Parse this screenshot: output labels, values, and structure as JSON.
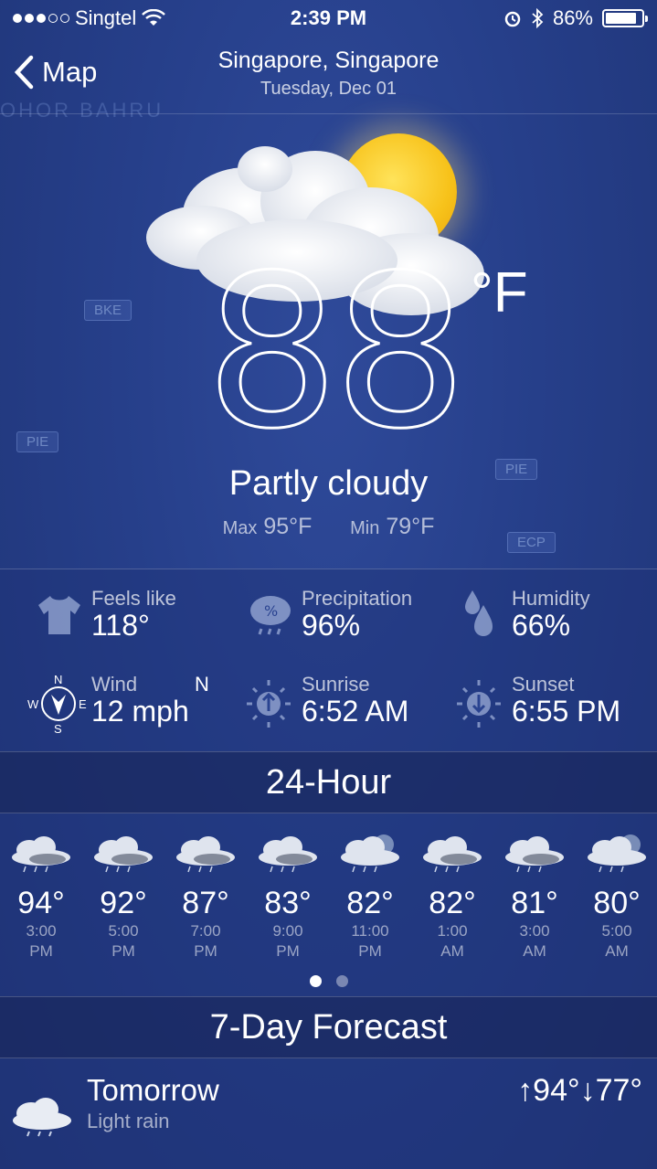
{
  "status_bar": {
    "carrier": "Singtel",
    "time": "2:39 PM",
    "battery": "86%",
    "battery_level": 0.86
  },
  "navbar": {
    "back_label": "Map",
    "title": "Singapore, Singapore",
    "subtitle": "Tuesday, Dec 01"
  },
  "current": {
    "temperature": "88",
    "unit": "°F",
    "condition": "Partly cloudy",
    "max_label": "Max",
    "max_value": "95°F",
    "min_label": "Min",
    "min_value": "79°F"
  },
  "details": {
    "feels_like": {
      "label": "Feels like",
      "value": "118°",
      "icon": "shirt-icon"
    },
    "precipitation": {
      "label": "Precipitation",
      "value": "96%",
      "icon": "rain-cloud-icon"
    },
    "humidity": {
      "label": "Humidity",
      "value": "66%",
      "icon": "droplets-icon"
    },
    "wind": {
      "label": "Wind",
      "value": "12 mph",
      "direction": "N",
      "icon": "compass-icon",
      "compass": {
        "n": "N",
        "s": "S",
        "e": "E",
        "w": "W"
      }
    },
    "sunrise": {
      "label": "Sunrise",
      "value": "6:52 AM",
      "icon": "sunrise-icon"
    },
    "sunset": {
      "label": "Sunset",
      "value": "6:55 PM",
      "icon": "sunset-icon"
    }
  },
  "hourly": {
    "title": "24-Hour",
    "items": [
      {
        "temp": "94°",
        "time": "3:00",
        "ampm": "PM",
        "icon": "thunderstorm-icon"
      },
      {
        "temp": "92°",
        "time": "5:00",
        "ampm": "PM",
        "icon": "thunderstorm-icon"
      },
      {
        "temp": "87°",
        "time": "7:00",
        "ampm": "PM",
        "icon": "thunderstorm-icon"
      },
      {
        "temp": "83°",
        "time": "9:00",
        "ampm": "PM",
        "icon": "thunderstorm-icon"
      },
      {
        "temp": "82°",
        "time": "11:00",
        "ampm": "PM",
        "icon": "cloudy-night-icon"
      },
      {
        "temp": "82°",
        "time": "1:00",
        "ampm": "AM",
        "icon": "thunderstorm-icon"
      },
      {
        "temp": "81°",
        "time": "3:00",
        "ampm": "AM",
        "icon": "thunderstorm-icon"
      },
      {
        "temp": "80°",
        "time": "5:00",
        "ampm": "AM",
        "icon": "cloudy-night-icon"
      }
    ],
    "page_count": 2,
    "current_page": 1
  },
  "forecast": {
    "title": "7-Day Forecast",
    "days": [
      {
        "name": "Tomorrow",
        "desc": "Light rain",
        "high": "94°",
        "low": "77°",
        "icon": "light-rain-icon"
      }
    ]
  },
  "colors": {
    "background": "#263f8a",
    "sun": "#f7c21a"
  }
}
